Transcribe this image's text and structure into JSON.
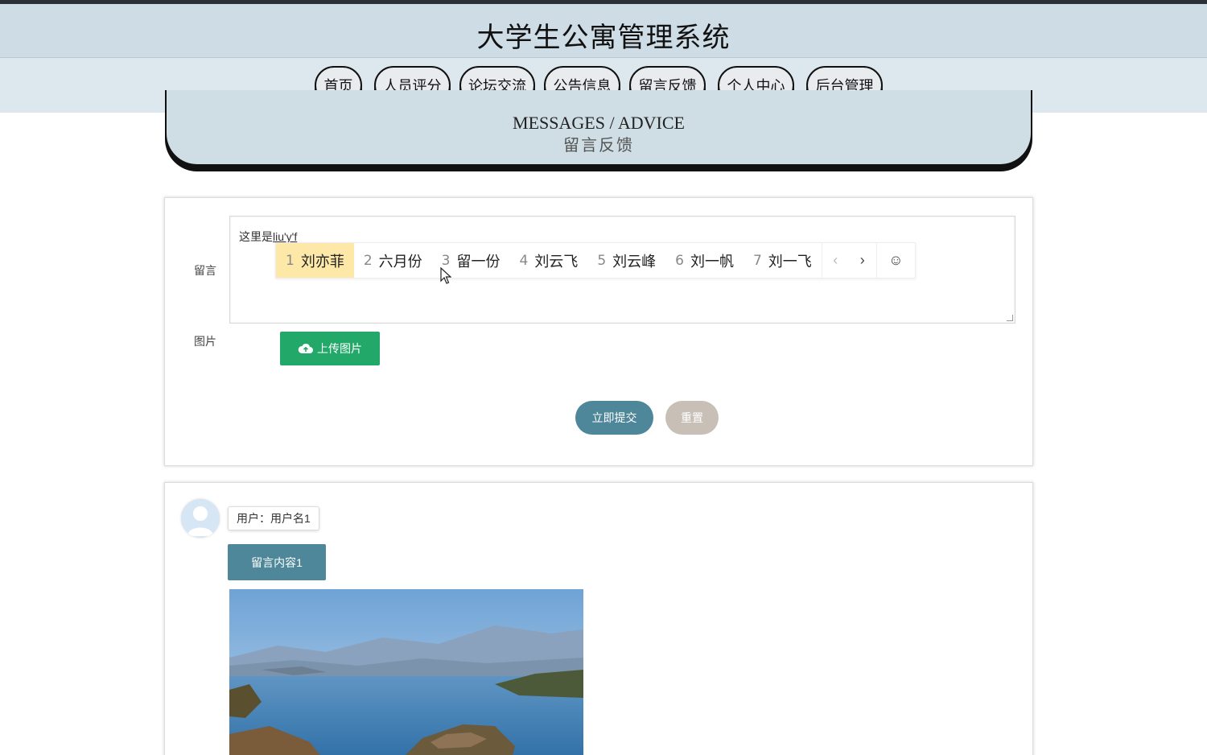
{
  "header": {
    "title": "大学生公寓管理系统"
  },
  "nav": {
    "items": [
      {
        "label": "首页"
      },
      {
        "label": "人员评分"
      },
      {
        "label": "论坛交流"
      },
      {
        "label": "公告信息"
      },
      {
        "label": "留言反馈"
      },
      {
        "label": "个人中心"
      },
      {
        "label": "后台管理"
      }
    ]
  },
  "banner": {
    "en": "MESSAGES / ADVICE",
    "cn": "留言反馈"
  },
  "form": {
    "message_label": "留言",
    "message_text_prefix": "这里是",
    "message_text_composing": "liu'y'f",
    "image_label": "图片",
    "upload_label": "上传图片",
    "submit_label": "立即提交",
    "reset_label": "重置"
  },
  "ime": {
    "candidates": [
      {
        "num": "1",
        "text": "刘亦菲"
      },
      {
        "num": "2",
        "text": "六月份"
      },
      {
        "num": "3",
        "text": "留一份"
      },
      {
        "num": "4",
        "text": "刘云飞"
      },
      {
        "num": "5",
        "text": "刘云峰"
      },
      {
        "num": "6",
        "text": "刘一帆"
      },
      {
        "num": "7",
        "text": "刘一飞"
      }
    ],
    "prev": "‹",
    "next": "›",
    "emoji": "☺"
  },
  "messages": [
    {
      "user": "用户：用户名1",
      "content": "留言内容1"
    }
  ],
  "colors": {
    "header_bg": "#cddce5",
    "nav_bg": "#dde8ee",
    "accent": "#4d8799",
    "upload_green": "#22a868",
    "reset_gray": "#c8bfb7",
    "ime_highlight": "#fde8a8"
  }
}
